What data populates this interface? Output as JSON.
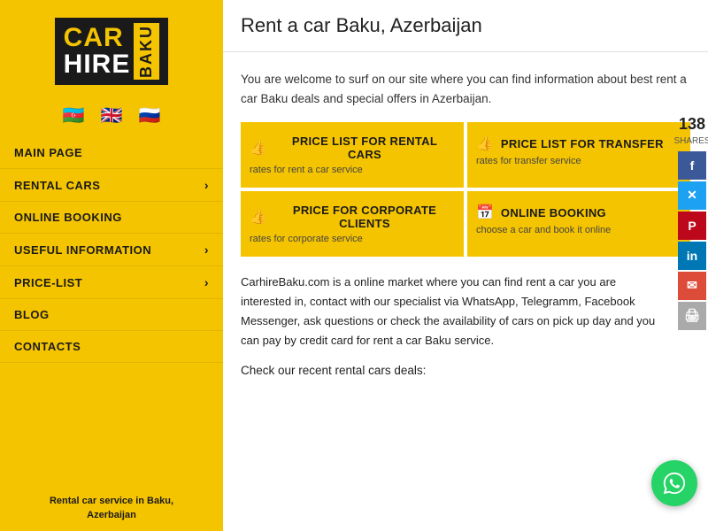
{
  "sidebar": {
    "logo": {
      "car": "CAR",
      "hire": "HIRE",
      "baku": "BAKU"
    },
    "flags": [
      "🇦🇿",
      "🇬🇧",
      "🇷🇺"
    ],
    "nav": [
      {
        "label": "MAIN PAGE",
        "hasArrow": false
      },
      {
        "label": "RENTAL CARS",
        "hasArrow": true
      },
      {
        "label": "ONLINE BOOKING",
        "hasArrow": false
      },
      {
        "label": "USEFUL INFORMATION",
        "hasArrow": true
      },
      {
        "label": "PRICE-LIST",
        "hasArrow": true
      },
      {
        "label": "BLOG",
        "hasArrow": false
      },
      {
        "label": "CONTACTS",
        "hasArrow": false
      }
    ],
    "footer": "Rental car service in Baku,\nAzerbaijan"
  },
  "header": {
    "title": "Rent a car Baku, Azerbaijan"
  },
  "intro": "You are welcome to surf on our site where you can find information about best rent a car Baku deals and special offers in Azerbaijan.",
  "actions": [
    {
      "label": "PRICE LIST FOR RENTAL CARS",
      "sub": "rates for rent a car service",
      "icon": "👍"
    },
    {
      "label": "PRICE LIST FOR TRANSFER",
      "sub": "rates for transfer service",
      "icon": "👍"
    },
    {
      "label": "PRICE FOR CORPORATE CLIENTS",
      "sub": "rates for corporate service",
      "icon": "👍"
    },
    {
      "label": "ONLINE BOOKING",
      "sub": "choose a car and book it online",
      "icon": "📅"
    }
  ],
  "shares": {
    "count": "138",
    "label": "SHARES"
  },
  "body_text": "CarhireBaku.com is a online market where you can find rent a car you are interested in, contact with our specialist via WhatsApp, Telegramm, Facebook Messenger, ask questions or check the availability of cars on pick up day and you can pay by credit card for rent a car Baku service.",
  "recent_deals": "Check our recent rental cars deals:"
}
